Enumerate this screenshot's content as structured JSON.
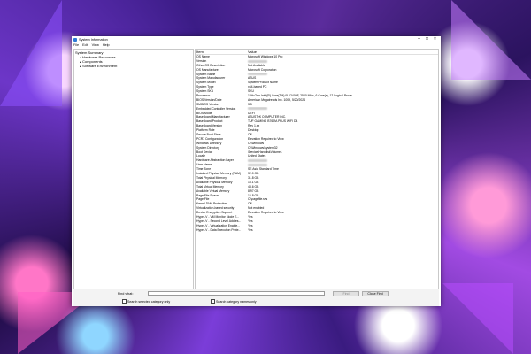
{
  "window": {
    "title": "System Information"
  },
  "menu": [
    "File",
    "Edit",
    "View",
    "Help"
  ],
  "tree": {
    "root": "System Summary",
    "children": [
      "Hardware Resources",
      "Components",
      "Software Environment"
    ]
  },
  "list": {
    "headers": {
      "item": "Item",
      "value": "Value"
    },
    "rows": [
      {
        "item": "OS Name",
        "value": "Microsoft Windows 10 Pro"
      },
      {
        "item": "Version",
        "value": "",
        "hidden": true
      },
      {
        "item": "Other OS Description",
        "value": "Not Available"
      },
      {
        "item": "OS Manufacturer",
        "value": "Microsoft Corporation"
      },
      {
        "item": "System Name",
        "value": "",
        "hidden": true
      },
      {
        "item": "System Manufacturer",
        "value": "ASUS"
      },
      {
        "item": "System Model",
        "value": "System Product Name"
      },
      {
        "item": "System Type",
        "value": "x64-based PC"
      },
      {
        "item": "System SKU",
        "value": "SKU"
      },
      {
        "item": "Processor",
        "value": "12th Gen Intel(R) Core(TM) i5-12400F, 2500 MHz, 6 Core(s), 12 Logical Proce..."
      },
      {
        "item": "BIOS Version/Date",
        "value": "American Megatrends Inc. 1009, 5/20/2024"
      },
      {
        "item": "SMBIOS Version",
        "value": "3.5"
      },
      {
        "item": "Embedded Controller Version",
        "value": "",
        "hidden": true
      },
      {
        "item": "BIOS Mode",
        "value": "UEFI"
      },
      {
        "item": "BaseBoard Manufacturer",
        "value": "ASUSTeK COMPUTER INC."
      },
      {
        "item": "BaseBoard Product",
        "value": "TUF GAMING B760M-PLUS WIFI D4"
      },
      {
        "item": "BaseBoard Version",
        "value": "Rev 1.xx"
      },
      {
        "item": "Platform Role",
        "value": "Desktop"
      },
      {
        "item": "Secure Boot State",
        "value": "Off"
      },
      {
        "item": "PCR7 Configuration",
        "value": "Elevation Required to View"
      },
      {
        "item": "Windows Directory",
        "value": "C:\\Windows"
      },
      {
        "item": "System Directory",
        "value": "C:\\Windows\\system32"
      },
      {
        "item": "Boot Device",
        "value": "\\Device\\HarddiskVolume1"
      },
      {
        "item": "Locale",
        "value": "United States"
      },
      {
        "item": "Hardware Abstraction Layer",
        "value": "",
        "hidden": true
      },
      {
        "item": "User Name",
        "value": "",
        "hidden": true
      },
      {
        "item": "Time Zone",
        "value": "SE Asia Standard Time"
      },
      {
        "item": "Installed Physical Memory (RAM)",
        "value": "32.0 GB"
      },
      {
        "item": "Total Physical Memory",
        "value": "31.8 GB"
      },
      {
        "item": "Available Physical Memory",
        "value": "15.1 GB"
      },
      {
        "item": "Total Virtual Memory",
        "value": "48.6 GB"
      },
      {
        "item": "Available Virtual Memory",
        "value": "8.97 GB"
      },
      {
        "item": "Page File Space",
        "value": "16.8 GB"
      },
      {
        "item": "Page File",
        "value": "C:\\pagefile.sys"
      },
      {
        "item": "Kernel DMA Protection",
        "value": "Off"
      },
      {
        "item": "Virtualization-based security",
        "value": "Not enabled"
      },
      {
        "item": "Device Encryption Support",
        "value": "Elevation Required to View"
      },
      {
        "item": "Hyper-V - VM Monitor Mode E...",
        "value": "Yes"
      },
      {
        "item": "Hyper-V - Second Level Addres...",
        "value": "Yes"
      },
      {
        "item": "Hyper-V - Virtualization Enable...",
        "value": "Yes"
      },
      {
        "item": "Hyper-V - Data Execution Prote...",
        "value": "Yes"
      }
    ]
  },
  "find": {
    "label": "Find what:",
    "value": "",
    "find_button": "Find",
    "close_button": "Close Find",
    "check1": "Search selected category only",
    "check2": "Search category names only"
  }
}
